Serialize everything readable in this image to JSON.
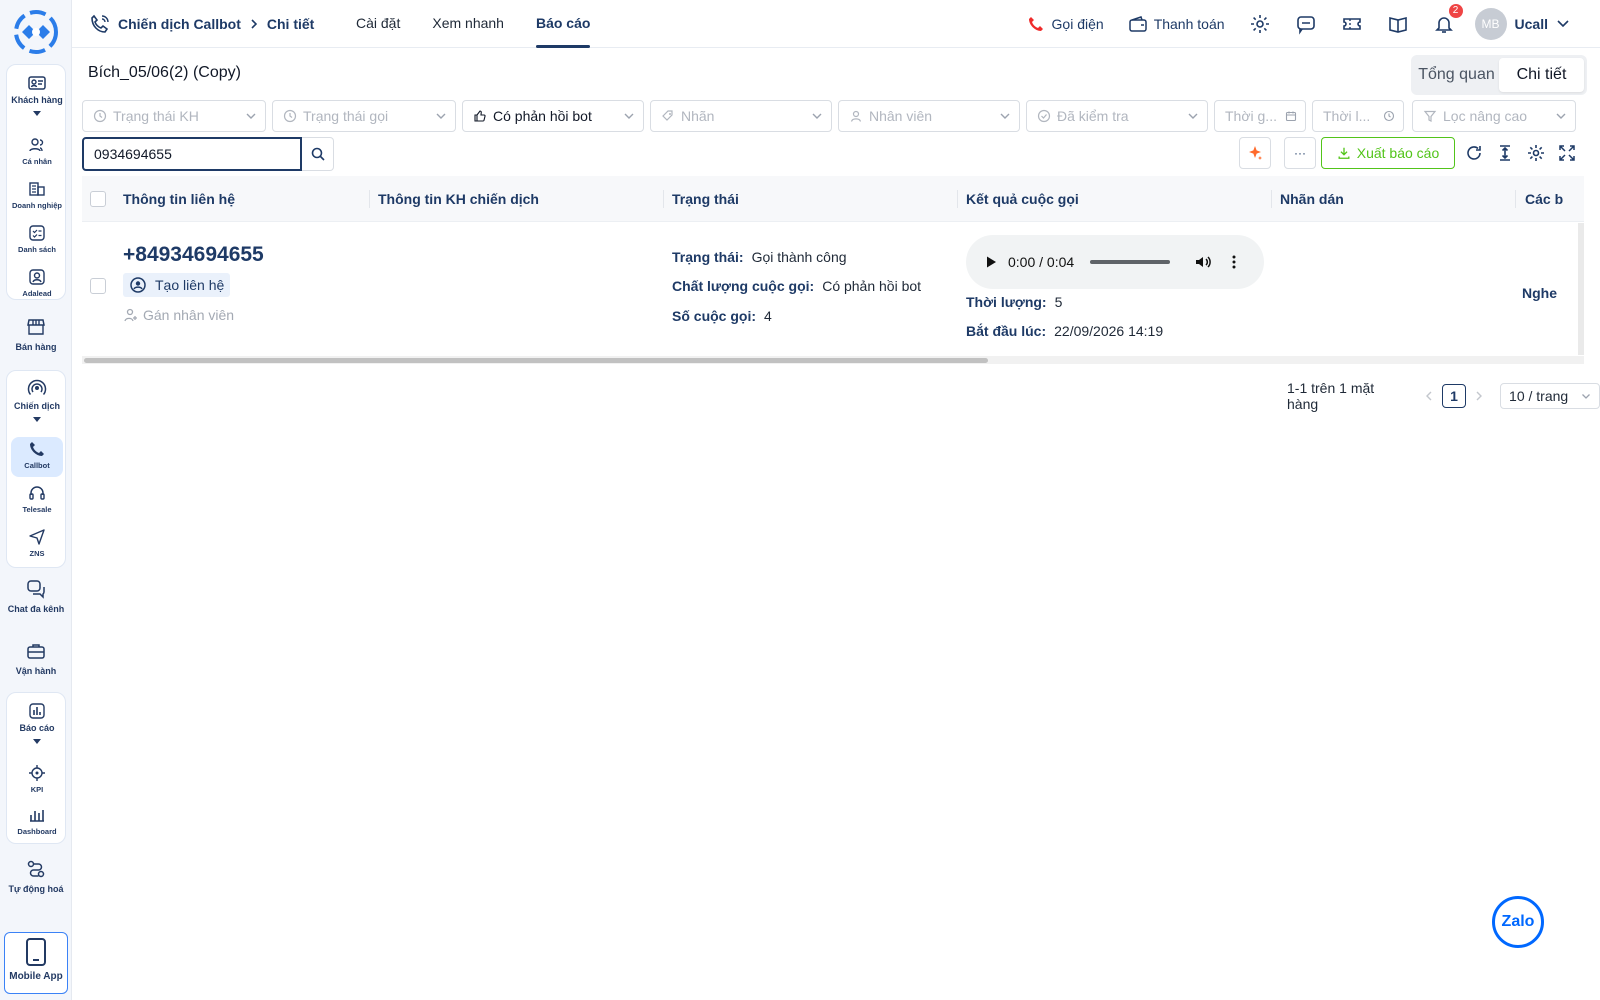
{
  "sidebar": {
    "groups": {
      "customers": {
        "label": "Khách hàng",
        "items": [
          "Cá nhân",
          "Doanh nghiệp",
          "Danh sách",
          "Adalead"
        ]
      },
      "sales": {
        "label": "Bán hàng"
      },
      "campaign": {
        "label": "Chiến dịch",
        "items": [
          "Callbot",
          "Telesale",
          "ZNS"
        ]
      },
      "omnichat": {
        "label": "Chat đa kênh"
      },
      "operations": {
        "label": "Vận hành"
      },
      "reports": {
        "label": "Báo cáo",
        "items": [
          "KPI",
          "Dashboard"
        ]
      },
      "automation": {
        "label": "Tự động hoá"
      },
      "mobile": {
        "label": "Mobile App"
      }
    },
    "active_item": "Callbot"
  },
  "header": {
    "breadcrumb": {
      "parent": "Chiến dịch Callbot",
      "current": "Chi tiết"
    },
    "tabs": [
      "Cài đặt",
      "Xem nhanh",
      "Báo cáo"
    ],
    "active_tab": "Báo cáo",
    "call_label": "Gọi điện",
    "payment_label": "Thanh toán",
    "notification_count": "2",
    "user_initials": "MB",
    "user_name": "Ucall"
  },
  "page": {
    "campaign_title": "Bích_05/06(2) (Copy)",
    "view_toggle": [
      "Tổng quan",
      "Chi tiết"
    ],
    "active_view": "Chi tiết"
  },
  "filters": {
    "customer_status": "Trạng thái KH",
    "call_status": "Trạng thái gọi",
    "bot_response": "Có phản hồi bot",
    "label": "Nhãn",
    "staff": "Nhân viên",
    "checked": "Đã kiểm tra",
    "time_from": "Thời g...",
    "time_to": "Thời l...",
    "advanced": "Lọc nâng cao"
  },
  "search": {
    "value": "0934694655"
  },
  "toolbar": {
    "more_label": "···",
    "export_label": "Xuất báo cáo"
  },
  "table": {
    "columns": [
      "Thông tin liên hệ",
      "Thông tin KH chiến dịch",
      "Trạng thái",
      "Kết quả cuộc gọi",
      "Nhãn dán",
      "Các b"
    ],
    "rows": [
      {
        "phone": "+84934694655",
        "create_contact_label": "Tạo liên hệ",
        "assign_label": "Gán nhân viên",
        "status_key": "Trạng thái:",
        "status_value": "Gọi thành công",
        "quality_key": "Chất lượng cuộc gọi:",
        "quality_value": "Có phản hồi bot",
        "call_count_key": "Số cuộc gọi:",
        "call_count_value": "4",
        "audio_time": "0:00 / 0:04",
        "duration_key": "Thời lượng:",
        "duration_value": "5",
        "start_key": "Bắt đầu lúc:",
        "start_value": "22/09/2026 14:19",
        "cut_text": "Nghe"
      }
    ]
  },
  "pagination": {
    "summary": "1-1 trên 1 mặt hàng",
    "current_page": "1",
    "page_size": "10 / trang"
  },
  "floating": {
    "zalo_label": "Zalo"
  },
  "colors": {
    "primary": "#1e3a66",
    "export": "#52c41a",
    "badge": "#ef4444",
    "active_nav": "#dbeaff"
  }
}
